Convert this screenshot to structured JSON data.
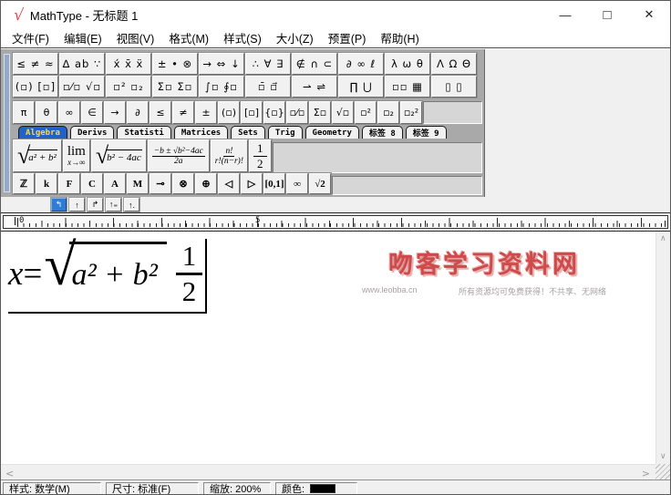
{
  "window": {
    "title": "MathType - 无标题 1",
    "logo_glyph": "√",
    "controls": {
      "minimize": "—",
      "maximize": "□",
      "close": "✕"
    }
  },
  "menu": {
    "items": [
      "文件(F)",
      "编辑(E)",
      "视图(V)",
      "格式(M)",
      "样式(S)",
      "大小(Z)",
      "预置(P)",
      "帮助(H)"
    ]
  },
  "toolbar": {
    "row1": [
      "≤ ≠ ≈",
      "∆ ab ∵",
      "x́ x̄ ẍ",
      "± • ⊗",
      "→ ⇔ ↓",
      "∴ ∀ ∃",
      "∉ ∩ ⊂",
      "∂ ∞ ℓ",
      "λ ω θ",
      "Λ Ω Θ"
    ],
    "row2": [
      "(▫) [▫]",
      "▫⁄▫ √▫",
      "▫² ▫₂",
      "Σ▫ Σ▫",
      "∫▫ ∮▫",
      "▫̄ ▫⃗",
      "⇀ ⇌",
      "∏ ⋃",
      "▫▫ ▦",
      "▯ ▯"
    ],
    "row3": [
      "π",
      "θ",
      "∞",
      "∈",
      "→",
      "∂",
      "≤",
      "≠",
      "±",
      "(▫)",
      "[▫]",
      "{▫}",
      "▫⁄▫",
      "Σ▫",
      "√▫",
      "▫²",
      "▫₂",
      "▫₂²"
    ],
    "letters": [
      "ℤ",
      "k",
      "F",
      "C",
      "A",
      "M",
      "⊸",
      "⊗",
      "⊕",
      "◁",
      "▷",
      "[0,1]",
      "∞",
      "√2"
    ]
  },
  "tabs": [
    "Algebra",
    "Derivs",
    "Statisti",
    "Matrices",
    "Sets",
    "Trig",
    "Geometry",
    "标签 8",
    "标签 9"
  ],
  "templates": {
    "t1": {
      "sign": "√",
      "content": "a² + b²"
    },
    "t2": {
      "top": "lim",
      "bottom": "x→∞"
    },
    "t3": {
      "sign": "√",
      "content": "b² − 4ac"
    },
    "t4": {
      "num": "−b ± √b²−4ac",
      "den": "2a"
    },
    "t5": {
      "num": "n!",
      "den": "r!(n−r)!"
    },
    "t6": {
      "num": "1",
      "den": "2"
    }
  },
  "tabstops": [
    "↰",
    "↑",
    "↱",
    "↑₌",
    "↑."
  ],
  "ruler": {
    "origin_label": "0",
    "mid_label": "5"
  },
  "formula": {
    "variable": "x",
    "equals": "=",
    "radical_sign": "√",
    "radicand": "a² + b²",
    "fraction": {
      "num": "1",
      "den": "2"
    }
  },
  "watermark": {
    "title": "吻客学习资料网",
    "url": "www.leobba.cn",
    "tagline": "所有资源均可免费获得！不共享、无网络"
  },
  "scrollbars": {
    "up": "∧",
    "down": "∨",
    "left": "<",
    "right": ">"
  },
  "statusbar": {
    "style_label": "样式: 数学(M)",
    "size_label": "尺寸: 标准(F)",
    "zoom_label": "缩放: 200%",
    "color_label": "颜色:"
  },
  "colors": {
    "accent_blue": "#2161c8",
    "tab_text_yellow": "#ffd937",
    "watermark_red": "#cf4a4a",
    "status_swatch": "#000000"
  }
}
